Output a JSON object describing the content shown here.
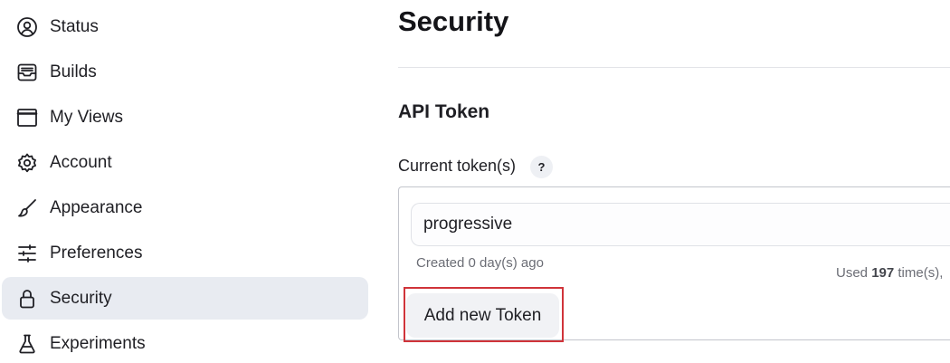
{
  "sidebar": {
    "items": [
      {
        "label": "Status",
        "icon": "user-circle-icon"
      },
      {
        "label": "Builds",
        "icon": "inbox-tray-icon"
      },
      {
        "label": "My Views",
        "icon": "window-icon"
      },
      {
        "label": "Account",
        "icon": "gear-icon"
      },
      {
        "label": "Appearance",
        "icon": "paintbrush-icon"
      },
      {
        "label": "Preferences",
        "icon": "sliders-icon"
      },
      {
        "label": "Security",
        "icon": "lock-icon",
        "active": true
      },
      {
        "label": "Experiments",
        "icon": "flask-icon"
      }
    ]
  },
  "main": {
    "title": "Security",
    "section_title": "API Token",
    "field_label": "Current token(s)",
    "help_label": "?",
    "token": {
      "name": "progressive",
      "created": "Created 0 day(s) ago",
      "usage_prefix": "Used ",
      "usage_count": "197",
      "usage_suffix": " time(s),"
    },
    "add_button_label": "Add new Token"
  },
  "colors": {
    "active_bg": "#e8ebf1",
    "highlight_border": "#d0343a",
    "muted_text": "#6b6d75"
  }
}
